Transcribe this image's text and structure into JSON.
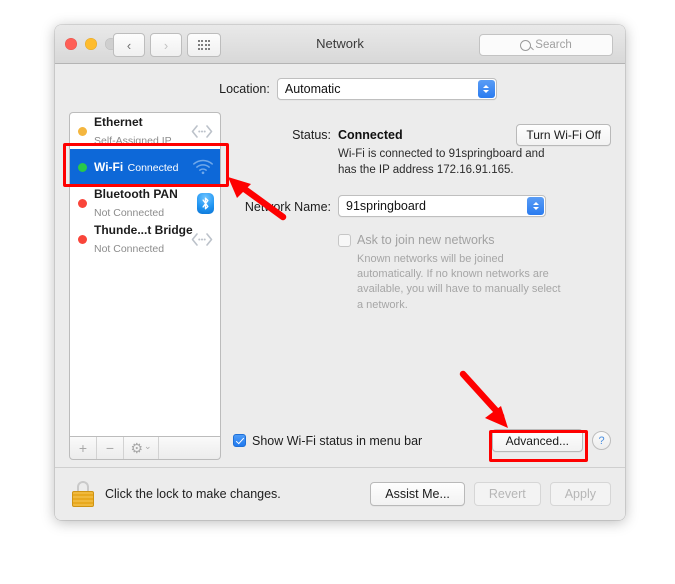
{
  "window": {
    "title": "Network",
    "traffic_lights": [
      "close-button",
      "minimize-button",
      "zoom-button"
    ],
    "back_label": "‹",
    "forward_label": "›",
    "grid_label": "show-all-grid",
    "search_placeholder": "Search"
  },
  "location": {
    "label": "Location:",
    "value": "Automatic"
  },
  "services": [
    {
      "name": "Ethernet",
      "status": "Self-Assigned IP",
      "dot_color": "#f4b63f",
      "icon": "ethernet-icon",
      "selected": false
    },
    {
      "name": "Wi-Fi",
      "status": "Connected",
      "dot_color": "#29c84a",
      "icon": "wifi-icon",
      "selected": true
    },
    {
      "name": "Bluetooth PAN",
      "status": "Not Connected",
      "dot_color": "#f9453a",
      "icon": "bluetooth-icon",
      "selected": false
    },
    {
      "name": "Thunde...t Bridge",
      "status": "Not Connected",
      "dot_color": "#f9453a",
      "icon": "thunderbolt-bridge-icon",
      "selected": false
    }
  ],
  "sidebar_toolbar": {
    "add_label": "+",
    "remove_label": "−",
    "gear_label": "⚙",
    "gear_chevron": "⌄"
  },
  "panel": {
    "status_label": "Status:",
    "status_value": "Connected",
    "turn_off_button": "Turn Wi-Fi Off",
    "status_description": "Wi-Fi is connected to 91springboard and has the IP address 172.16.91.165.",
    "network_name_label": "Network Name:",
    "network_name_value": "91springboard",
    "ask_join_label": "Ask to join new networks",
    "ask_join_checked": false,
    "ask_join_help": "Known networks will be joined automatically. If no known networks are available, you will have to manually select a network.",
    "show_status_label": "Show Wi-Fi status in menu bar",
    "show_status_checked": true,
    "advanced_button": "Advanced...",
    "help_button": "?"
  },
  "footer": {
    "lock_icon": "lock-icon",
    "lock_text": "Click the lock to make changes.",
    "assist_button": "Assist Me...",
    "revert_button": "Revert",
    "apply_button": "Apply"
  },
  "annotations": {
    "highlight_color": "#fe0000",
    "boxes": [
      "wifi-service-row",
      "advanced-button"
    ],
    "arrows": [
      "arrow-to-wifi-row",
      "arrow-to-advanced-button"
    ]
  }
}
